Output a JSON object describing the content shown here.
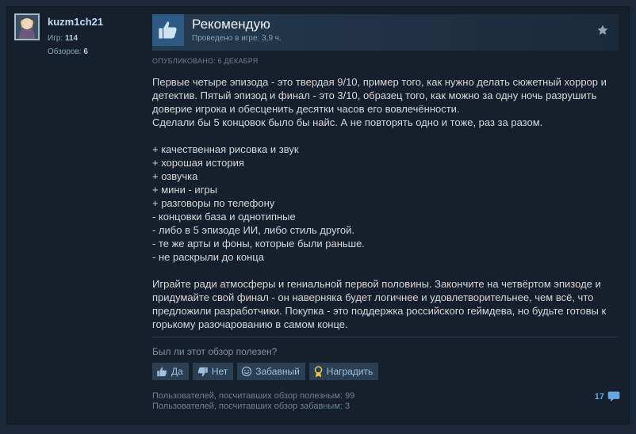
{
  "user": {
    "name": "kuzm1ch21",
    "games_label": "Игр:",
    "games_count": "114",
    "reviews_label": "Обзоров:",
    "reviews_count": "6"
  },
  "review": {
    "recommendation": "Рекомендую",
    "hours": "Проведено в игре: 3,9 ч.",
    "posted": "ОПУБЛИКОВАНО: 6 ДЕКАБРЯ",
    "lines": [
      "Первые четыре эпизода - это твердая 9/10, пример того, как нужно делать сюжетный хоррор и",
      "детектив. Пятый эпизод и финал - это 3/10, образец того, как можно за одну ночь разрушить",
      "доверие игрока и обесценить десятки часов его вовлечённости.",
      "Сделали бы 5 концовок было бы найс. А не повторять одно и тоже, раз за разом.",
      "",
      "+ качественная рисовка и звук",
      "+ хорошая история",
      "+ озвучка",
      "+ мини - игры",
      "+ разговоры по телефону",
      "- концовки база и однотипные",
      "- либо в 5 эпизоде ИИ, либо стиль другой.",
      "- те же арты и фоны, которые были раньше.",
      "- не раскрыли до конца",
      "",
      "Играйте ради атмосферы и гениальной первой половины. Закончите на четвёртом эпизоде и",
      "придумайте свой финал - он наверняка будет логичнее и удовлетворительнее, чем всё, что",
      "предложили разработчики. Покупка - это поддержка российского геймдева, но будьте готовы к",
      "горькому разочарованию в самом конце."
    ]
  },
  "feedback": {
    "question": "Был ли этот обзор полезен?",
    "yes": "Да",
    "no": "Нет",
    "funny": "Забавный",
    "award": "Наградить",
    "helpful_count_text": "Пользователей, посчитавших обзор полезным: 99",
    "funny_count_text": "Пользователей, посчитавших обзор забавным: 3",
    "comments_count": "17"
  },
  "colors": {
    "background": "#1b2838",
    "link": "#67a7de",
    "thumb_tile": "#2d5a85"
  },
  "icons": {
    "recommend": "thumbs-up-icon",
    "star": "star-icon",
    "yes": "thumbs-up-icon",
    "no": "thumbs-down-icon",
    "funny": "smile-icon",
    "award": "award-icon",
    "comments": "comment-icon"
  }
}
